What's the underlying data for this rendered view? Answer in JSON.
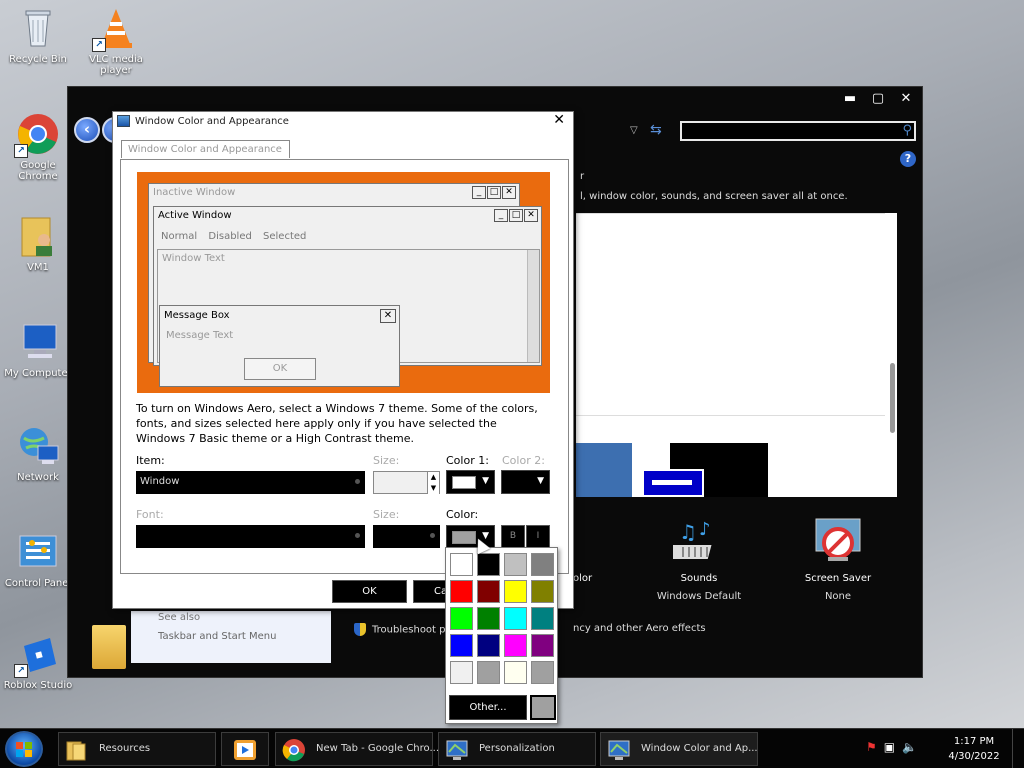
{
  "desktop": {
    "icons": [
      {
        "label": "Recycle Bin",
        "icon": "recycle-bin-icon"
      },
      {
        "label": "VLC media player",
        "icon": "vlc-icon"
      },
      {
        "label": "Google Chrome",
        "icon": "chrome-icon"
      },
      {
        "label": "VM1",
        "icon": "user-folder-icon"
      },
      {
        "label": "My Computer",
        "icon": "computer-icon"
      },
      {
        "label": "Network",
        "icon": "network-icon"
      },
      {
        "label": "Control Panel",
        "icon": "control-panel-icon"
      },
      {
        "label": "Roblox Studio",
        "icon": "roblox-icon"
      }
    ]
  },
  "personalization": {
    "caption_buttons": [
      "▬",
      "▢",
      "✕"
    ],
    "desc_partial": "r",
    "desc_line": "l, window color, sounds, and screen saver all at once.",
    "tiles": [
      {
        "label": "Sounds",
        "sub": "Windows Default"
      },
      {
        "label": "Screen Saver",
        "sub": "None"
      }
    ],
    "color_tail": "olor",
    "see_also_title": "See also",
    "see_also_link": "Taskbar and Start Menu",
    "troubleshoot": "Troubleshoot p",
    "troubleshoot_tail": "ncy and other Aero effects"
  },
  "dialog": {
    "title": "Window Color and Appearance",
    "tab": "Window Color and Appearance",
    "preview": {
      "inactive_title": "Inactive Window",
      "active_title": "Active Window",
      "menu": [
        "Normal",
        "Disabled",
        "Selected"
      ],
      "window_text": "Window Text",
      "msgbox_title": "Message Box",
      "msgbox_text": "Message Text",
      "ok": "OK"
    },
    "instructions": "To turn on Windows Aero, select a Windows 7 theme.  Some of the colors, fonts, and sizes selected here apply only if you have selected the Windows 7 Basic theme or a High Contrast theme.",
    "item_label": "Item:",
    "item_value": "Window",
    "size_label": "Size:",
    "color1_label": "Color 1:",
    "color2_label": "Color 2:",
    "font_label": "Font:",
    "font_size_label": "Size:",
    "font_color_label": "Color:",
    "bold": "B",
    "italic": "I",
    "ok_button": "OK",
    "cancel_partial": "Ca",
    "color1_value": "#ffffff",
    "font_color_value": "#a0a0a0"
  },
  "picker": {
    "colors": [
      "#ffffff",
      "#000000",
      "#c0c0c0",
      "#808080",
      "#ff0000",
      "#800000",
      "#ffff00",
      "#808000",
      "#00ff00",
      "#008000",
      "#00ffff",
      "#008080",
      "#0000ff",
      "#000080",
      "#ff00ff",
      "#800080",
      "#f0f0f0",
      "#a0a0a0",
      "#fffff0",
      "#a0a0a0"
    ],
    "other_label": "Other...",
    "current": "#a0a0a0"
  },
  "taskbar": {
    "items": [
      {
        "label": "Resources",
        "icon": "folder-icon"
      },
      {
        "label": "",
        "icon": "media-player-icon"
      },
      {
        "label": "New Tab - Google Chro...",
        "icon": "chrome-icon"
      },
      {
        "label": "Personalization",
        "icon": "personalization-icon"
      },
      {
        "label": "Window Color and Ap...",
        "icon": "personalization-icon"
      }
    ],
    "time": "1:17 PM",
    "date": "4/30/2022"
  }
}
